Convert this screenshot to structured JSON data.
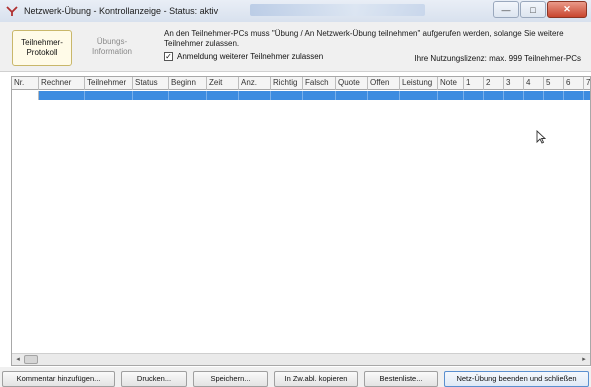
{
  "window": {
    "title": "Netzwerk-Übung - Kontrollanzeige - Status: aktiv",
    "controls": {
      "minimize": "—",
      "maximize": "□",
      "close": "✕"
    }
  },
  "tabs": [
    {
      "label_line1": "Teilnehmer-",
      "label_line2": "Protokoll",
      "active": true
    },
    {
      "label_line1": "Übungs-",
      "label_line2": "Information",
      "active": false
    }
  ],
  "info": {
    "text": "An den Teilnehmer-PCs muss \"Übung / An Netzwerk-Übung teilnehmen\" aufgerufen werden, solange Sie weitere Teilnehmer zulassen.",
    "checkbox_label": "Anmeldung weiterer Teilnehmer zulassen",
    "checkbox_checked": true,
    "license": "Ihre Nutzungslizenz: max. 999 Teilnehmer-PCs"
  },
  "grid": {
    "columns": [
      "Nr.",
      "Rechner",
      "Teilnehmer",
      "Status",
      "Beginn",
      "Zeit",
      "Anz.",
      "Richtig",
      "Falsch",
      "Quote",
      "Offen",
      "Leistung",
      "Note",
      "1",
      "2",
      "3",
      "4",
      "5",
      "6",
      "7"
    ],
    "selection_color": "#3d8ce0"
  },
  "scrollbar": {
    "left_arrow": "◂",
    "right_arrow": "▸"
  },
  "buttons": [
    {
      "label": "Kommentar hinzufügen..."
    },
    {
      "label": "Drucken..."
    },
    {
      "label": "Speichern..."
    },
    {
      "label": "In Zw.abl. kopieren"
    },
    {
      "label": "Bestenliste..."
    },
    {
      "label": "Netz-Übung beenden und schließen"
    }
  ]
}
